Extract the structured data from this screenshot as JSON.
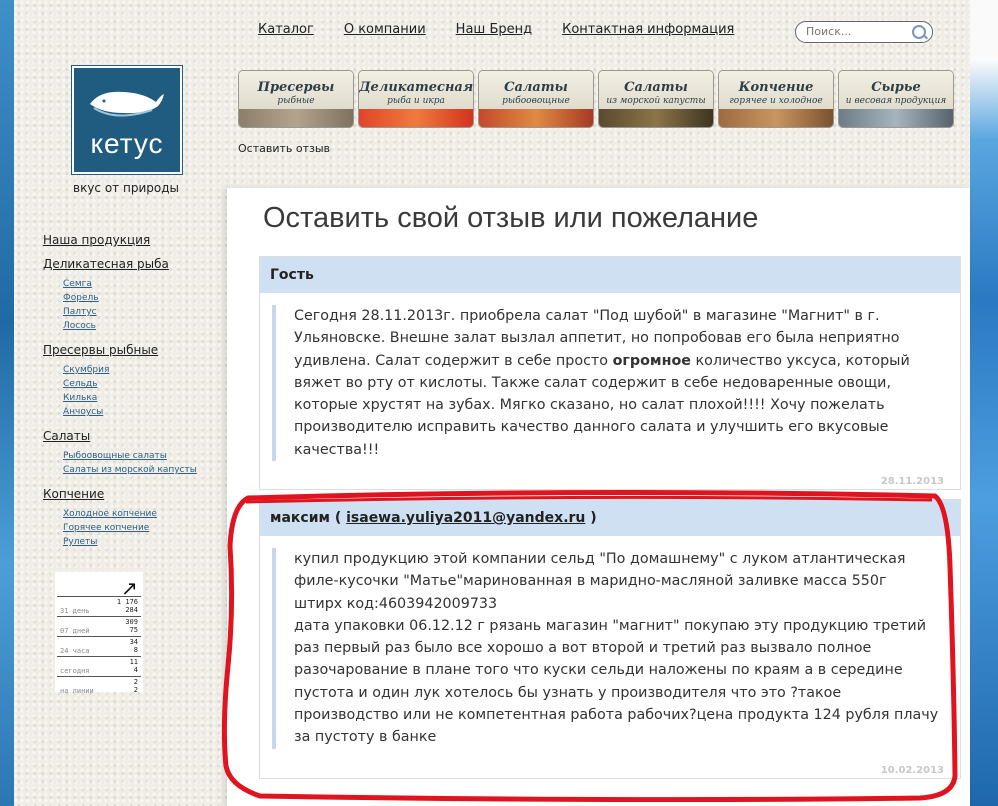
{
  "nav": {
    "top": [
      "Каталог",
      "О компании",
      "Наш Бренд",
      "Контактная информация"
    ],
    "search_placeholder": "Поиск..."
  },
  "logo": {
    "brand": "кетус",
    "tagline": "вкус от природы"
  },
  "tiles": [
    {
      "t1": "Пресервы",
      "t2": "рыбные",
      "photo": "#9b8f7e"
    },
    {
      "t1": "Деликатесная",
      "t2": "рыба и икра",
      "photo": "#d9582f"
    },
    {
      "t1": "Салаты",
      "t2": "рыбоовощные",
      "photo": "#c96a3a"
    },
    {
      "t1": "Салаты",
      "t2": "из морской капусты",
      "photo": "#6b5a3d"
    },
    {
      "t1": "Копчение",
      "t2": "горячее и холодное",
      "photo": "#a57a4f"
    },
    {
      "t1": "Сырье",
      "t2": "и весовая продукция",
      "photo": "#7b8a96"
    }
  ],
  "breadcrumb": "Оставить отзыв",
  "left_nav": [
    {
      "title": "Наша продукция",
      "items": []
    },
    {
      "title": "Деликатесная рыба",
      "items": [
        "Семга",
        "Форель",
        "Палтус",
        "Лосось"
      ]
    },
    {
      "title": "Пресервы рыбные",
      "items": [
        "Скумбрия",
        "Сельдь",
        "Килька",
        "Анчоусы"
      ]
    },
    {
      "title": "Салаты",
      "items": [
        "Рыбоовощные салаты",
        "Салаты из морской капусты"
      ]
    },
    {
      "title": "Копчение",
      "items": [
        "Холодное копчение",
        "Горячее копчение",
        "Рулеты"
      ]
    }
  ],
  "counter": {
    "arrow": "↗",
    "rows": [
      {
        "label": "31 день",
        "v1": "1 176",
        "v2": "284"
      },
      {
        "label": "07 дней",
        "v1": "309",
        "v2": "75"
      },
      {
        "label": "24 часа",
        "v1": "34",
        "v2": "8"
      },
      {
        "label": "сегодня",
        "v1": "11",
        "v2": "4"
      },
      {
        "label": "на линии",
        "v1": "2",
        "v2": "2"
      }
    ]
  },
  "page_title": "Оставить свой отзыв или пожелание",
  "comments": [
    {
      "author": "Гость",
      "email": "",
      "text_before": "Сегодня 28.11.2013г. приобрела салат \"Под шубой\" в магазине \"Магнит\" в г. Ульяновске. Внешне залат вызлал аппетит, но попробовав его была неприятно удивлена. Салат содержит в себе просто ",
      "text_bold": "огромное",
      "text_after": " количество уксуса, который вяжет во рту от кислоты. Также салат содержит в себе недоваренные овощи, которые хрустят на зубах. Мягко сказано, но салат плохой!!!! Хочу пожелать производителю исправить качество данного салата и улучшить его вкусовые качества!!!",
      "date": "28.11.2013"
    },
    {
      "author": "максим",
      "email": "isaewa.yuliya2011@yandex.ru",
      "lines": [
        "купил продукцию этой компании сельд \"По домашнему\" с луком атлантическая филе-кусочки \"Матье\"маринованная в маридно-масляной заливке масса 550г",
        "штирх код:4603942009733",
        "дата упаковки 06.12.12 г рязань магазин \"магнит\" покупаю эту продукцию третий раз первый раз было все хорошо а вот второй и третий раз вызвало полное разочарование в плане того что куски сельди наложены по краям а в середине пустота и один лук хотелось бы узнать у производителя что это ?такое производство или не компетентная работа рабочих?цена продукта 124 рубля плачу за пустоту в банке"
      ],
      "date": "10.02.2013"
    }
  ],
  "colors": {
    "comment_header": "#cfe0f2",
    "logo_bg": "#1f5c80",
    "annotation_red": "#e0141e"
  }
}
